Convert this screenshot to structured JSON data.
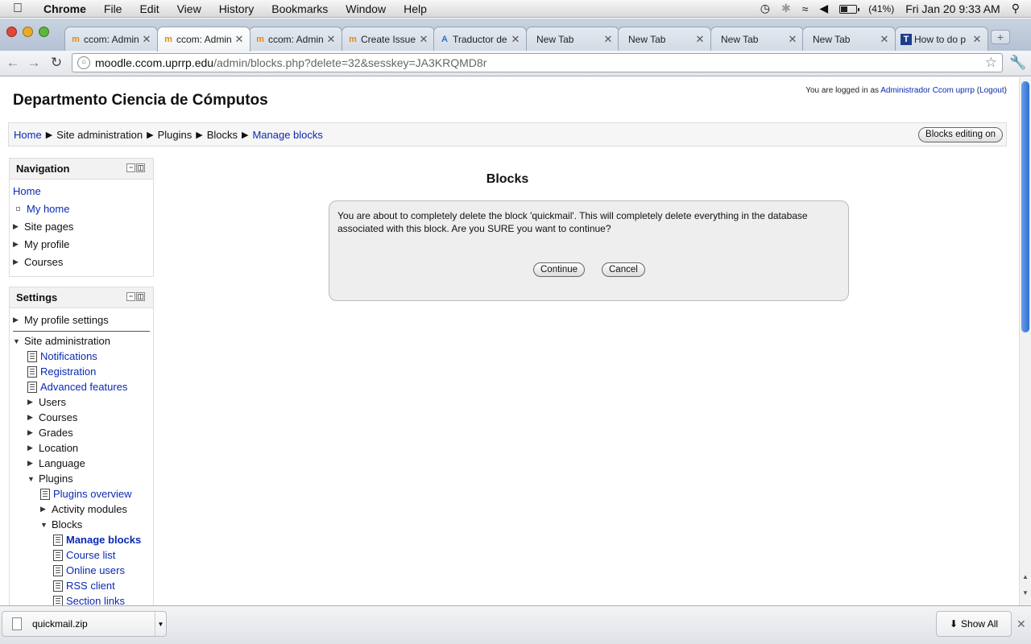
{
  "menubar": {
    "app": "Chrome",
    "items": [
      "File",
      "Edit",
      "View",
      "History",
      "Bookmarks",
      "Window",
      "Help"
    ],
    "battery": "(41%)",
    "battery_level": 0.41,
    "clock": "Fri Jan 20  9:33 AM"
  },
  "tabs": [
    {
      "title": "ccom: Admin",
      "icon": "moodle-icon",
      "active": false
    },
    {
      "title": "ccom: Admin",
      "icon": "moodle-icon",
      "active": true
    },
    {
      "title": "ccom: Admin",
      "icon": "moodle-icon",
      "active": false
    },
    {
      "title": "Create Issue",
      "icon": "moodle-icon",
      "active": false
    },
    {
      "title": "Traductor de",
      "icon": "translate-icon",
      "active": false
    },
    {
      "title": "New Tab",
      "icon": "",
      "active": false
    },
    {
      "title": "New Tab",
      "icon": "",
      "active": false
    },
    {
      "title": "New Tab",
      "icon": "",
      "active": false
    },
    {
      "title": "New Tab",
      "icon": "",
      "active": false
    },
    {
      "title": "How to do p",
      "icon": "site-icon",
      "active": false
    }
  ],
  "toolbar": {
    "url_host": "moodle.ccom.uprrp.edu",
    "url_path": "/admin/blocks.php?delete=32&sesskey=JA3KRQMD8r"
  },
  "page": {
    "site_title": "Departmento Ciencia de Cómputos",
    "login_prefix": "You are logged in as ",
    "login_user": "Administrador Ccom uprrp",
    "logout": "Logout",
    "breadcrumb": [
      "Home",
      "Site administration",
      "Plugins",
      "Blocks",
      "Manage blocks"
    ],
    "blocks_editing_button": "Blocks editing on",
    "heading": "Blocks",
    "confirm_message": "You are about to completely delete the block 'quickmail'. This will completely delete everything in the database associated with this block. Are you SURE you want to continue?",
    "continue_button": "Continue",
    "cancel_button": "Cancel"
  },
  "navigation_block": {
    "title": "Navigation",
    "home": "Home",
    "items": [
      "My home",
      "Site pages",
      "My profile",
      "Courses"
    ]
  },
  "settings_block": {
    "title": "Settings",
    "my_profile_settings": "My profile settings",
    "site_admin": "Site administration",
    "admin_items": [
      "Notifications",
      "Registration",
      "Advanced features",
      "Users",
      "Courses",
      "Grades",
      "Location",
      "Language",
      "Plugins"
    ],
    "plugin_items": [
      "Plugins overview",
      "Activity modules",
      "Blocks"
    ],
    "block_items": [
      "Manage blocks",
      "Course list",
      "Online users",
      "RSS client",
      "Section links"
    ]
  },
  "download_shelf": {
    "file_name": "quickmail.zip",
    "show_all": "Show All"
  }
}
